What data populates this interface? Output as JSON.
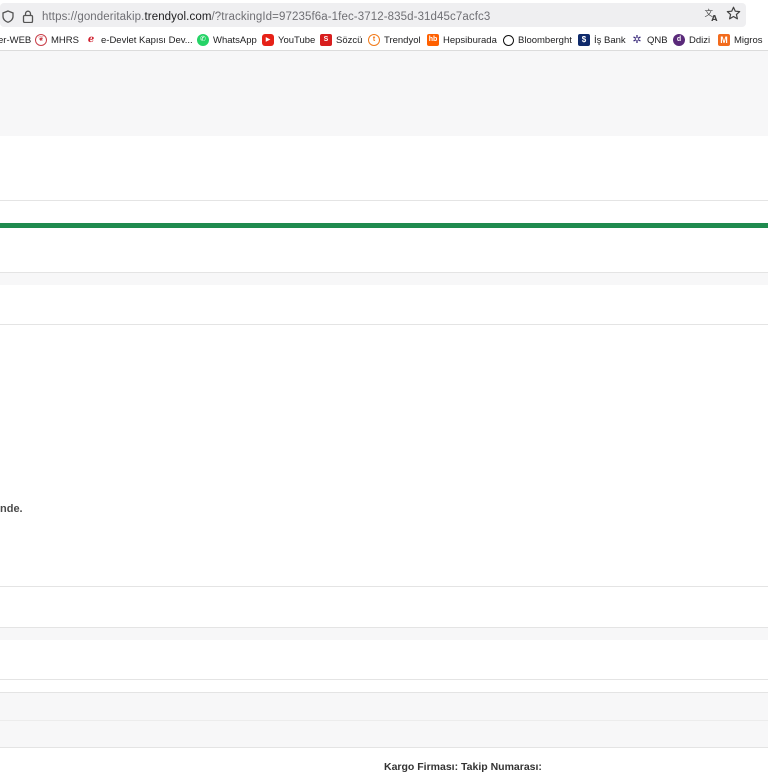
{
  "browser": {
    "url_prefix": "https://gonderitakip.",
    "url_domain": "trendyol.com",
    "url_rest": "/?trackingId=97235f6a-1fec-3712-835d-31d45c7acfc3",
    "icons": [
      "shield-icon",
      "lock-icon",
      "translate-icon",
      "star-icon"
    ]
  },
  "bookmarks": [
    {
      "label": "er-WEB",
      "icon": "none"
    },
    {
      "label": "MHRS",
      "icon": "mhrs-icon"
    },
    {
      "label": "e-Devlet Kapısı Dev...",
      "icon": "edevlet-icon"
    },
    {
      "label": "WhatsApp",
      "icon": "whatsapp-icon"
    },
    {
      "label": "YouTube",
      "icon": "youtube-icon"
    },
    {
      "label": "Sözcü",
      "icon": "sozcu-icon"
    },
    {
      "label": "Trendyol",
      "icon": "trendyol-icon"
    },
    {
      "label": "Hepsiburada",
      "icon": "hepsiburada-icon"
    },
    {
      "label": "Bloomberght",
      "icon": "bloomberght-icon"
    },
    {
      "label": "İş Bank",
      "icon": "isbank-icon"
    },
    {
      "label": "QNB",
      "icon": "qnb-icon"
    },
    {
      "label": "Ddizi",
      "icon": "ddizi-icon"
    },
    {
      "label": "Migros",
      "icon": "migros-icon"
    }
  ],
  "page": {
    "status_text": "nde.",
    "bottom_text": "Kargo Firması: Takip Numarası:",
    "colors": {
      "accent_green": "#1f8b4f",
      "band_gray": "#f7f7f8",
      "divider": "#e4e4e4"
    }
  }
}
